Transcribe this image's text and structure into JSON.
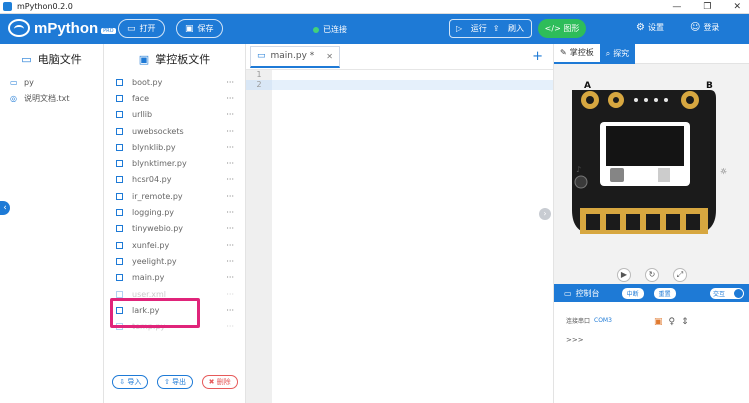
{
  "window": {
    "title": "mPython0.2.0",
    "controls": [
      "—",
      "❐",
      "✕"
    ]
  },
  "header": {
    "app_name": "mPython",
    "app_badge": "PRO",
    "open_label": "打开",
    "save_label": "保存",
    "connection_status": "已连接",
    "run_label": "运行",
    "flash_label": "刷入",
    "graphic_label": "图形",
    "settings_label": "设置",
    "login_label": "登录"
  },
  "pc_panel": {
    "title": "电脑文件",
    "items": [
      {
        "name": "py",
        "icon": "folder-icon"
      },
      {
        "name": "说明文档.txt",
        "icon": "doc-icon"
      }
    ]
  },
  "board_panel": {
    "title": "掌控板文件",
    "files": [
      "boot.py",
      "face",
      "urllib",
      "uwebsockets",
      "blynklib.py",
      "blynktimer.py",
      "hcsr04.py",
      "ir_remote.py",
      "logging.py",
      "tinywebio.py",
      "xunfei.py",
      "yeelight.py",
      "main.py",
      "user.xml",
      "lark.py",
      "temp.py"
    ],
    "actions": {
      "import_label": "导入",
      "export_label": "导出",
      "delete_label": "删除"
    }
  },
  "editor": {
    "tab_label": "main.py *",
    "line_numbers": [
      "1",
      "2"
    ]
  },
  "right_panel": {
    "tab_board": "掌控板",
    "tab_explore": "探究",
    "console_title": "控制台",
    "btn_interrupt": "中断",
    "btn_reset": "重置",
    "toggle_label": "交互",
    "serial_label": "连接串口",
    "serial_port": "COM3",
    "prompt": ">>>"
  },
  "colors": {
    "accent": "#1e7ad6",
    "success": "#2ebd5a",
    "danger": "#e65a5a",
    "highlight": "#e0247a"
  }
}
